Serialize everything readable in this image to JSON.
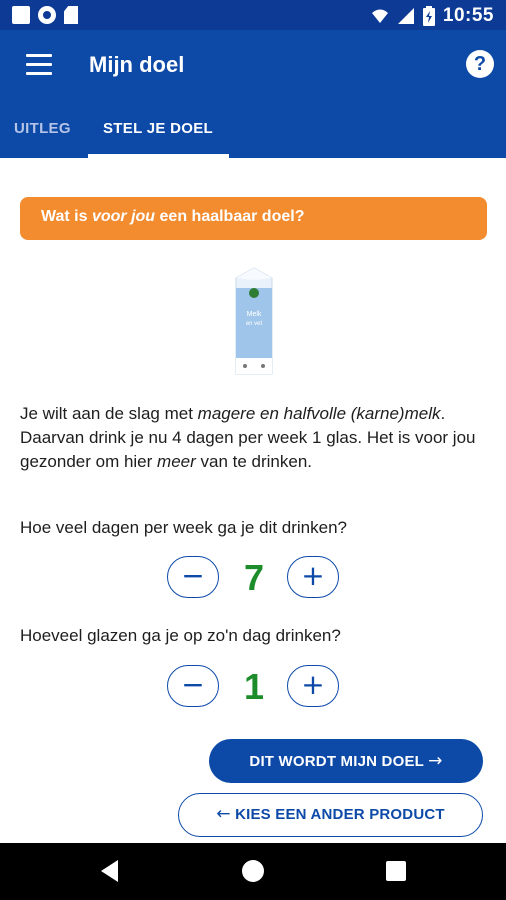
{
  "status_bar": {
    "time": "10:55"
  },
  "app_bar": {
    "title": "Mijn doel",
    "help_icon": "?"
  },
  "tabs": [
    {
      "label": "UITLEG",
      "active": false
    },
    {
      "label": "STEL JE DOEL",
      "active": true
    }
  ],
  "banner": {
    "prefix": "Wat is ",
    "emphasis": "voor jou",
    "suffix": " een haalbaar doel?",
    "color": "#f38b2f"
  },
  "product_image": {
    "brand_text": "Melk",
    "sub_text": "en vet"
  },
  "description": {
    "p1": "Je wilt aan de slag met ",
    "p1_em": "magere en halfvolle (karne)melk",
    "p2": ". Daarvan drink je nu 4 dagen per week 1 glas. Het is voor jou gezonder om hier ",
    "p2_em": "meer",
    "p3": " van te drinken."
  },
  "questions": {
    "days": {
      "label": "Hoe veel dagen per week ga je dit drinken?",
      "value": "7"
    },
    "glasses": {
      "label": "Hoeveel glazen ga je op zo'n dag drinken?",
      "value": "1"
    }
  },
  "stepper": {
    "minus": "−",
    "plus": "+"
  },
  "buttons": {
    "confirm": "DIT WORDT MIJN DOEL",
    "confirm_arrow": "→",
    "other_product": "KIES EEN ANDER PRODUCT",
    "other_arrow": "←"
  },
  "colors": {
    "primary": "#0d4aa8",
    "accent": "#f38b2f",
    "value": "#1d8c2b"
  }
}
